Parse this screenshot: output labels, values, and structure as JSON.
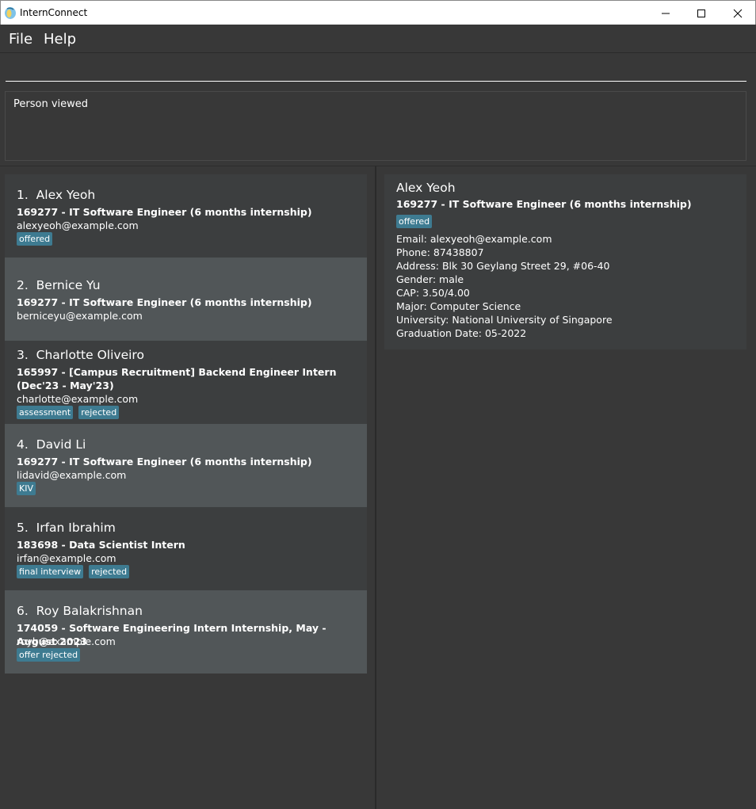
{
  "window": {
    "title": "InternConnect",
    "controls": {
      "minimize": "—",
      "maximize": "☐",
      "close": "✕"
    }
  },
  "menu": {
    "file": "File",
    "help": "Help"
  },
  "command": {
    "value": "",
    "placeholder": ""
  },
  "result": {
    "text": "Person viewed"
  },
  "persons": [
    {
      "index": "1.",
      "name": "Alex Yeoh",
      "job": "169277 - IT Software Engineer (6 months internship)",
      "email": "alexyeoh@example.com",
      "tags": [
        "offered"
      ]
    },
    {
      "index": "2.",
      "name": "Bernice Yu",
      "job": "169277 - IT Software Engineer (6 months internship)",
      "email": "berniceyu@example.com",
      "tags": []
    },
    {
      "index": "3.",
      "name": "Charlotte Oliveiro",
      "job": "165997 - [Campus Recruitment] Backend Engineer Intern (Dec'23 - May'23)",
      "email": "charlotte@example.com",
      "tags": [
        "assessment",
        "rejected"
      ]
    },
    {
      "index": "4.",
      "name": "David Li",
      "job": "169277 - IT Software Engineer (6 months internship)",
      "email": "lidavid@example.com",
      "tags": [
        "KIV"
      ]
    },
    {
      "index": "5.",
      "name": "Irfan Ibrahim",
      "job": "183698 - Data Scientist Intern",
      "email": "irfan@example.com",
      "tags": [
        "final interview",
        "rejected"
      ]
    },
    {
      "index": "6.",
      "name": "Roy Balakrishnan",
      "job": "174059 - Software Engineering Intern Internship, May - August 2023",
      "email": "royb@example.com",
      "tags": [
        "offer rejected"
      ]
    }
  ],
  "detail": {
    "name": "Alex Yeoh",
    "job": "169277 - IT Software Engineer (6 months internship)",
    "tags": [
      "offered"
    ],
    "fields": {
      "email": "Email: alexyeoh@example.com",
      "phone": "Phone: 87438807",
      "address": "Address: Blk 30 Geylang Street 29, #06-40",
      "gender": "Gender: male",
      "cap": "CAP: 3.50/4.00",
      "major": "Major: Computer Science",
      "university": "University: National University of Singapore",
      "graduation": "Graduation Date: 05-2022"
    }
  },
  "colors": {
    "background": "#383838",
    "card_even": "#3c3e3f",
    "card_odd": "#515658",
    "tag": "#3e7b91"
  }
}
